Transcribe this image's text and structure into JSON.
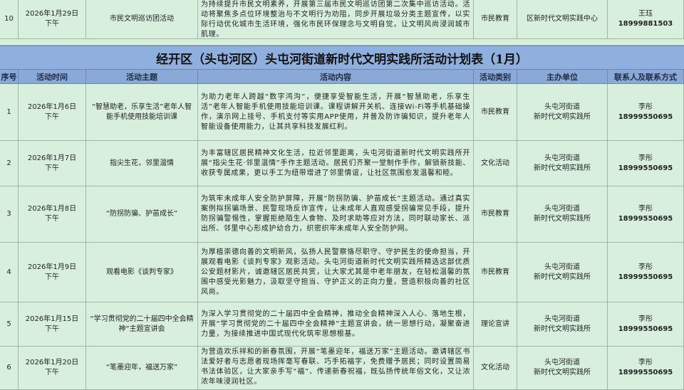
{
  "title": "经开区（头屯河区）头屯河街道新时代文明实践所活动计划表（1月）",
  "headers": [
    "序号",
    "活动时间",
    "活动主题",
    "活动内容",
    "活动类别",
    "主办单位",
    "联系人及联系方式"
  ],
  "top_row": {
    "no": "10",
    "date": "2026年1月29日",
    "period": "下午",
    "theme": "市民文明巡访团活动",
    "content": "为持续提升市民文明素养，开展第三届市民文明巡访团第二次集中巡访活动。活动将聚焦多点位环境整治与不文明行为劝阻，同步开展垃圾分类主题宣传，以实际行动优化城市生活环境，强化市民环保理念与文明自觉，让文明风尚浸润城市肌理。",
    "category": "市民教育",
    "organizer": "区新时代文明实践中心",
    "contact_name": "王珏",
    "contact_phone": "18999881503"
  },
  "rows": [
    {
      "no": "1",
      "date": "2026年1月6日",
      "period": "下午",
      "theme": "“智慧助老，乐享生活”老年人智能手机使用技能培训课",
      "content": "为助力老年人跨越“数字鸿沟”，便捷享受智能生活，开展“智慧助老，乐享生活”老年人智能手机使用技能培训课。课程讲解开关机、连接Wi-Fi等手机基础操作，演示网上挂号、手机支付等实用APP使用，并普及防诈骗知识，提升老年人智能设备使用能力，让其共享科技发展红利。",
      "category": "市民教育",
      "organizer_line1": "头屯河街道",
      "organizer_line2": "新时代文明实践所",
      "contact_name": "李彤",
      "contact_phone": "18999550695"
    },
    {
      "no": "2",
      "date": "2026年1月7日",
      "period": "下午",
      "theme": "指尖生花，邻里温情",
      "content": "为丰富辖区居民精神文化生活，拉近邻里距离，头屯河街道新时代文明实践所开展“指尖生花·邻里温情”手作主题活动。居民们齐聚一堂制作手作，解锁新技能、收获专属成果，更以手工为纽带增进了邻里情谊，让社区氛围愈发温馨和睦。",
      "category": "文化活动",
      "organizer_line1": "头屯河街道",
      "organizer_line2": "新时代文明实践所",
      "contact_name": "李彤",
      "contact_phone": "18999550695"
    },
    {
      "no": "3",
      "date": "2026年1月8日",
      "period": "下午",
      "theme": "“防拐防骗、护苗成长”",
      "content": "为筑牢未成年人安全防护屏障，开展“防拐防骗、护苗成长”主题活动。通过真实案例拟拐骗场景、民警现场反诈宣传，让未成年人直观感受拐骗常见手段，提升防拐骗警惕性，掌握拒绝陌生人食物、及时求助等应对方法，同时联动家长、派出所、邻里中心形成护幼合力，织密织牢未成年人安全防护网。",
      "category": "市民教育",
      "organizer_line1": "头屯河街道",
      "organizer_line2": "新时代文明实践所",
      "contact_name": "李彤",
      "contact_phone": "18999550695"
    },
    {
      "no": "4",
      "date": "2026年1月9日",
      "period": "下午",
      "theme": "观看电影《谈判专家》",
      "content": "为厚植崇德向善的文明新风，弘扬人民警察恪尽职守、守护民生的使命担当，开展观看电影《谈判专家》观影活动。头屯河街道新时代文明实践所精选这部优质公安题材影片，诚邀辖区居民共赏，让大家尤其是中老年朋友，在轻松温馨的氛围中感受光影魅力，汲取坚守担当、守护正义的正向力量，营造积极向善的社区风尚。",
      "category": "市民教育",
      "organizer_line1": "头屯河街道",
      "organizer_line2": "新时代文明实践所",
      "contact_name": "李彤",
      "contact_phone": "18999550695"
    },
    {
      "no": "5",
      "date": "2026年1月15日",
      "period": "下午",
      "theme": "“学习贯彻党的二十届四中全会精神”主题宣讲会",
      "content": "为深入学习贯彻党的二十届四中全会精神，推动全会精神深入人心、落地生根，开展“学习贯彻党的二十届四中全会精神”主题宣讲会，统一思想行动，凝聚奋进力量，为接续推进中国式现代化筑牢思想根基。",
      "category": "理论宣讲",
      "organizer_line1": "头屯河街道",
      "organizer_line2": "新时代文明实践所",
      "contact_name": "李彤",
      "contact_phone": "18999550695"
    },
    {
      "no": "6",
      "date": "2026年1月20日",
      "period": "下午",
      "theme": "“笔墨迎年，福送万家”",
      "content": "为营造欢乐祥和的新春氛围，开展“笔墨迎年，福送万家”主题活动。邀请辖区书法爱好者与志愿者现场挥毫写春联、巧手拓福字，免费赠予居民；同时设置简易书法体验区，让大家亲手写“福”、传递新春祝福，既弘扬传统年俗文化，又让浓浓年味浸润社区。",
      "category": "文化活动",
      "organizer_line1": "头屯河街道",
      "organizer_line2": "新时代文明实践所",
      "contact_name": "李彤",
      "contact_phone": "18999550695"
    }
  ]
}
